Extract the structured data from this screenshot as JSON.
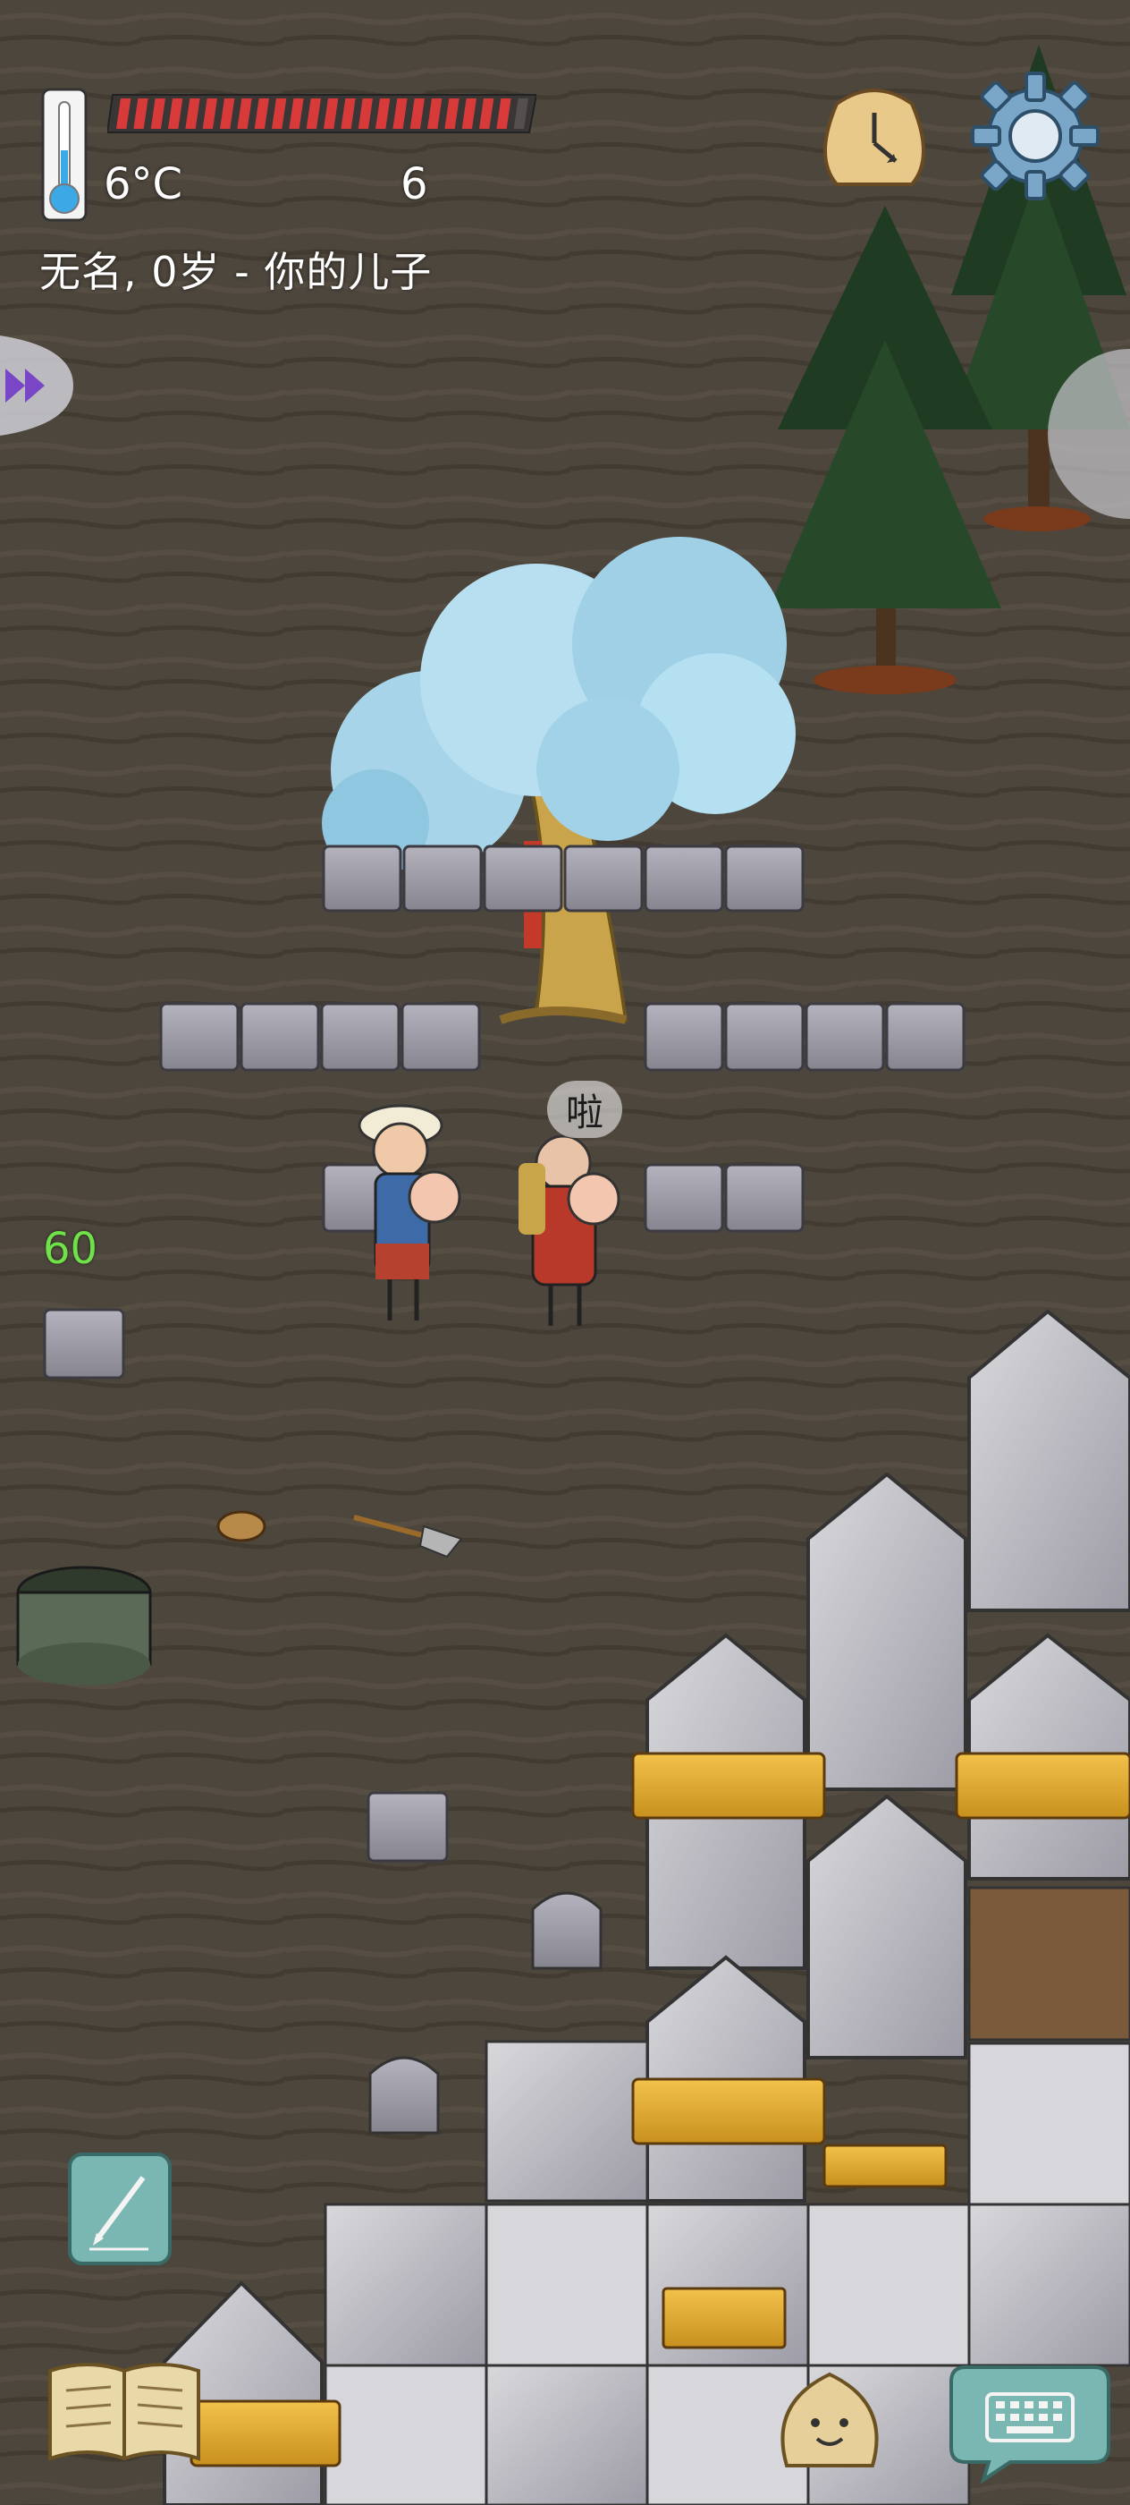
{
  "hud": {
    "temperature": "6°C",
    "food_count": "6",
    "player_info": "无名, 0岁 - 你的儿子",
    "food_fill": 0.97,
    "age_counter": "60"
  },
  "speech": {
    "text": "啦"
  },
  "icons": {
    "thermometer": "thermometer-icon",
    "clock": "clock-icon",
    "settings": "gear-icon",
    "arrow": "double-arrow-icon",
    "pencil": "pencil-icon",
    "book": "book-icon",
    "emote": "emote-face-icon",
    "keyboard": "keyboard-icon"
  },
  "colors": {
    "ground": "#4a4238",
    "food_bar": "#d83a3a",
    "age_counter": "#6fe24a",
    "tree_leaves": "#9fd0e6",
    "stone": "#9b9aa3"
  }
}
